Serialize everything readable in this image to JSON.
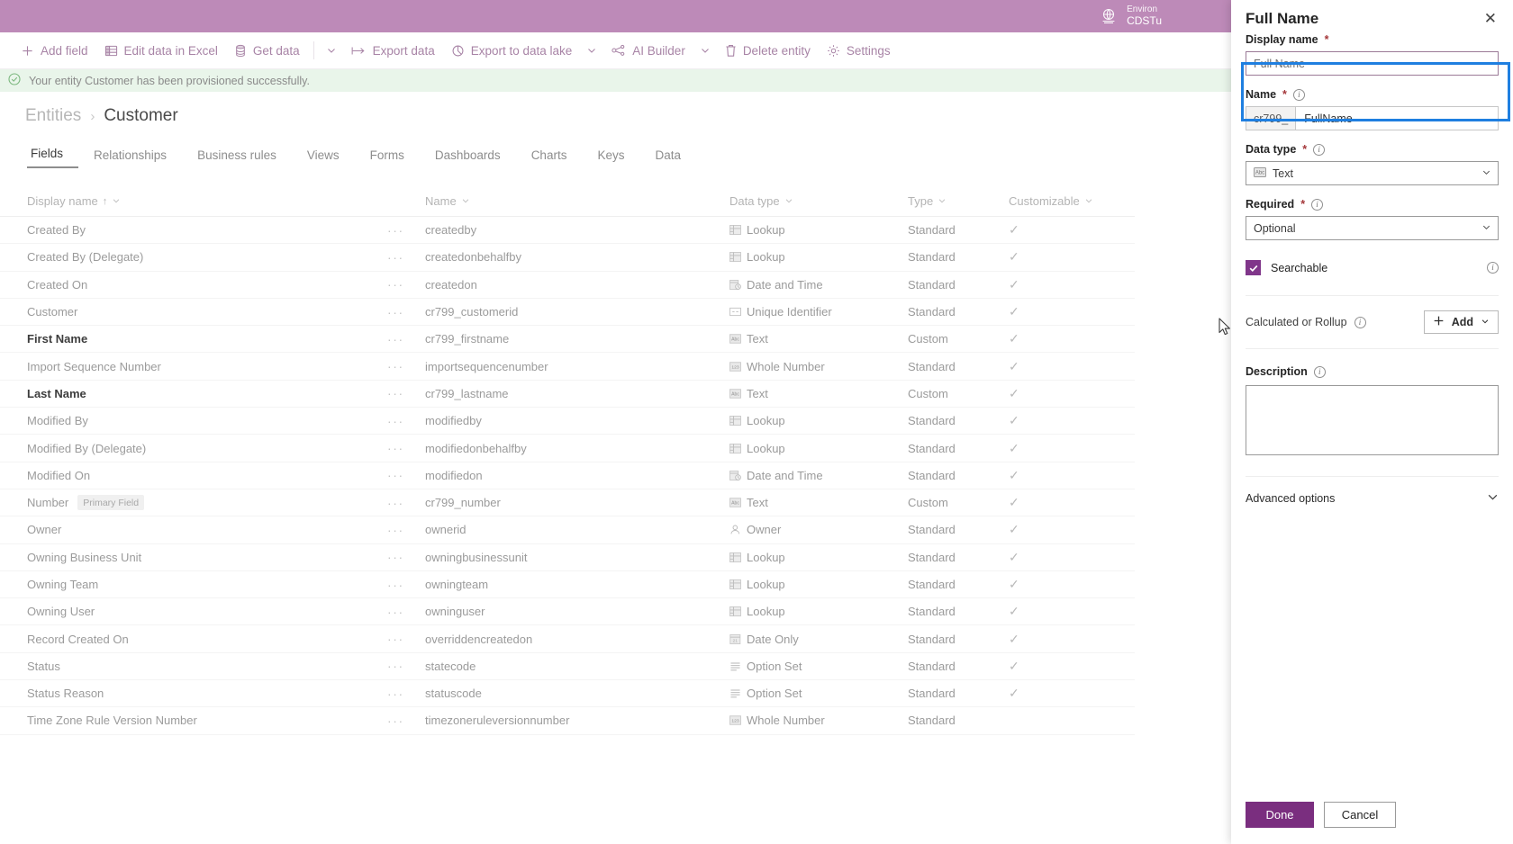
{
  "topbar": {
    "environment_label": "Environ",
    "environment_name": "CDSTu",
    "globe_icon": "globe-icon"
  },
  "command_bar": {
    "items": [
      {
        "label": "Add field",
        "icon": "plus-icon"
      },
      {
        "label": "Edit data in Excel",
        "icon": "excel-icon"
      },
      {
        "label": "Get data",
        "icon": "database-icon"
      },
      {
        "label": "",
        "icon": "chevron-down-icon"
      },
      {
        "label": "Export data",
        "icon": "export-icon"
      },
      {
        "label": "Export to data lake",
        "icon": "datalake-icon"
      },
      {
        "label": "",
        "icon": "chevron-down-icon"
      },
      {
        "label": "AI Builder",
        "icon": "ai-builder-icon"
      },
      {
        "label": "",
        "icon": "chevron-down-icon"
      },
      {
        "label": "Delete entity",
        "icon": "trash-icon"
      },
      {
        "label": "Settings",
        "icon": "gear-icon"
      }
    ]
  },
  "banner": {
    "icon": "check-circle-icon",
    "message": "Your entity Customer has been provisioned successfully."
  },
  "breadcrumb": {
    "root": "Entities",
    "separator": "›",
    "current": "Customer"
  },
  "tabs": [
    {
      "label": "Fields",
      "active": true
    },
    {
      "label": "Relationships",
      "active": false
    },
    {
      "label": "Business rules",
      "active": false
    },
    {
      "label": "Views",
      "active": false
    },
    {
      "label": "Forms",
      "active": false
    },
    {
      "label": "Dashboards",
      "active": false
    },
    {
      "label": "Charts",
      "active": false
    },
    {
      "label": "Keys",
      "active": false
    },
    {
      "label": "Data",
      "active": false
    }
  ],
  "grid": {
    "columns": [
      {
        "label": "Display name",
        "sorted": "↑"
      },
      {
        "label": "Name",
        "sorted": ""
      },
      {
        "label": "Data type",
        "sorted": ""
      },
      {
        "label": "Type",
        "sorted": ""
      },
      {
        "label": "Customizable",
        "sorted": ""
      }
    ],
    "ellipsis": "···",
    "check_glyph": "✓",
    "primary_field_badge": "Primary Field",
    "rows": [
      {
        "display": "Created By",
        "bold": false,
        "badge": "",
        "name": "createdby",
        "dtype": "Lookup",
        "dicon": "lookup-icon",
        "type": "Standard",
        "customizable": true
      },
      {
        "display": "Created By (Delegate)",
        "bold": false,
        "badge": "",
        "name": "createdonbehalfby",
        "dtype": "Lookup",
        "dicon": "lookup-icon",
        "type": "Standard",
        "customizable": true
      },
      {
        "display": "Created On",
        "bold": false,
        "badge": "",
        "name": "createdon",
        "dtype": "Date and Time",
        "dicon": "datetime-icon",
        "type": "Standard",
        "customizable": true
      },
      {
        "display": "Customer",
        "bold": false,
        "badge": "",
        "name": "cr799_customerid",
        "dtype": "Unique Identifier",
        "dicon": "guid-icon",
        "type": "Standard",
        "customizable": true
      },
      {
        "display": "First Name",
        "bold": true,
        "badge": "",
        "name": "cr799_firstname",
        "dtype": "Text",
        "dicon": "text-icon",
        "type": "Custom",
        "customizable": true
      },
      {
        "display": "Import Sequence Number",
        "bold": false,
        "badge": "",
        "name": "importsequencenumber",
        "dtype": "Whole Number",
        "dicon": "number-icon",
        "type": "Standard",
        "customizable": true
      },
      {
        "display": "Last Name",
        "bold": true,
        "badge": "",
        "name": "cr799_lastname",
        "dtype": "Text",
        "dicon": "text-icon",
        "type": "Custom",
        "customizable": true
      },
      {
        "display": "Modified By",
        "bold": false,
        "badge": "",
        "name": "modifiedby",
        "dtype": "Lookup",
        "dicon": "lookup-icon",
        "type": "Standard",
        "customizable": true
      },
      {
        "display": "Modified By (Delegate)",
        "bold": false,
        "badge": "",
        "name": "modifiedonbehalfby",
        "dtype": "Lookup",
        "dicon": "lookup-icon",
        "type": "Standard",
        "customizable": true
      },
      {
        "display": "Modified On",
        "bold": false,
        "badge": "",
        "name": "modifiedon",
        "dtype": "Date and Time",
        "dicon": "datetime-icon",
        "type": "Standard",
        "customizable": true
      },
      {
        "display": "Number",
        "bold": false,
        "badge": "Primary Field",
        "name": "cr799_number",
        "dtype": "Text",
        "dicon": "text-icon",
        "type": "Custom",
        "customizable": true
      },
      {
        "display": "Owner",
        "bold": false,
        "badge": "",
        "name": "ownerid",
        "dtype": "Owner",
        "dicon": "owner-icon",
        "type": "Standard",
        "customizable": true
      },
      {
        "display": "Owning Business Unit",
        "bold": false,
        "badge": "",
        "name": "owningbusinessunit",
        "dtype": "Lookup",
        "dicon": "lookup-icon",
        "type": "Standard",
        "customizable": true
      },
      {
        "display": "Owning Team",
        "bold": false,
        "badge": "",
        "name": "owningteam",
        "dtype": "Lookup",
        "dicon": "lookup-icon",
        "type": "Standard",
        "customizable": true
      },
      {
        "display": "Owning User",
        "bold": false,
        "badge": "",
        "name": "owninguser",
        "dtype": "Lookup",
        "dicon": "lookup-icon",
        "type": "Standard",
        "customizable": true
      },
      {
        "display": "Record Created On",
        "bold": false,
        "badge": "",
        "name": "overriddencreatedon",
        "dtype": "Date Only",
        "dicon": "dateonly-icon",
        "type": "Standard",
        "customizable": true
      },
      {
        "display": "Status",
        "bold": false,
        "badge": "",
        "name": "statecode",
        "dtype": "Option Set",
        "dicon": "optionset-icon",
        "type": "Standard",
        "customizable": true
      },
      {
        "display": "Status Reason",
        "bold": false,
        "badge": "",
        "name": "statuscode",
        "dtype": "Option Set",
        "dicon": "optionset-icon",
        "type": "Standard",
        "customizable": true
      },
      {
        "display": "Time Zone Rule Version Number",
        "bold": false,
        "badge": "",
        "name": "timezoneruleversionnumber",
        "dtype": "Whole Number",
        "dicon": "number-icon",
        "type": "Standard",
        "customizable": false
      }
    ]
  },
  "panel": {
    "title": "Full Name",
    "close_glyph": "✕",
    "display_name": {
      "label": "Display name",
      "required_mark": "*",
      "value": "Full Name",
      "placeholder": "Full Name"
    },
    "name": {
      "label": "Name",
      "required_mark": "*",
      "prefix": "cr799_",
      "value": "FullName"
    },
    "data_type": {
      "label": "Data type",
      "required_mark": "*",
      "value": "Text",
      "icon": "text-icon"
    },
    "required": {
      "label": "Required",
      "required_mark": "*",
      "value": "Optional"
    },
    "searchable": {
      "label": "Searchable",
      "checked": true
    },
    "calculated_or_rollup": {
      "label": "Calculated or Rollup",
      "add_label": "Add"
    },
    "description": {
      "label": "Description",
      "value": ""
    },
    "advanced_options": {
      "label": "Advanced options"
    },
    "footer": {
      "done_label": "Done",
      "cancel_label": "Cancel"
    }
  },
  "colors": {
    "brand_bar": "#bd8ab8",
    "primary_button": "#7a2e7f",
    "checkbox": "#80368a",
    "focus_outline": "#1f7fe0",
    "banner_bg": "#e9f5ea"
  }
}
